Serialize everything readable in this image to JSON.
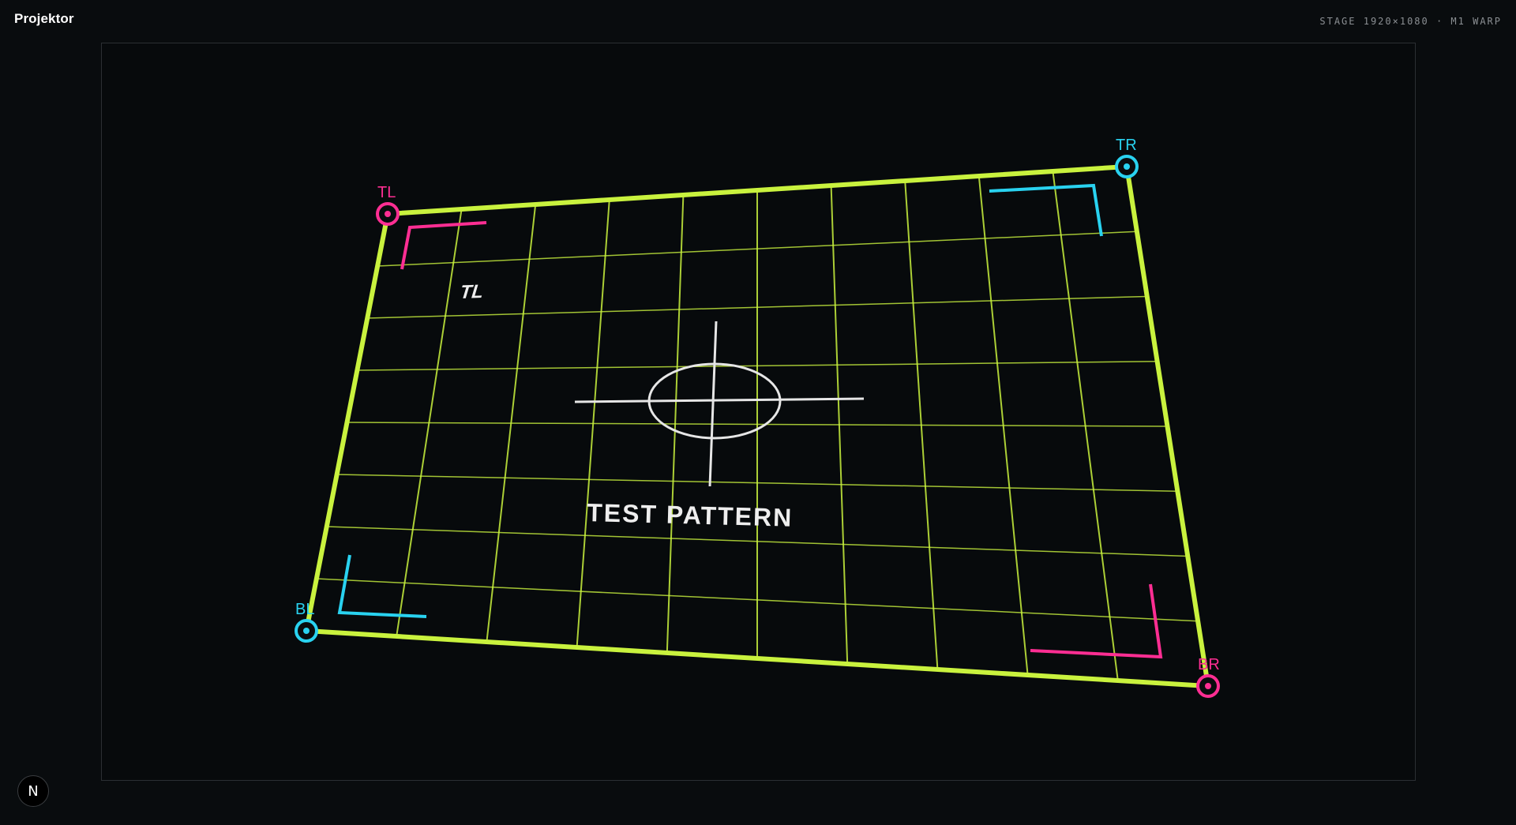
{
  "app": {
    "title": "Projektor",
    "stage_info": "STAGE 1920×1080 · M1 WARP"
  },
  "pattern": {
    "label": "TEST PATTERN",
    "corner_text": "TL"
  },
  "handles": {
    "tl": "TL",
    "tr": "TR",
    "bl": "BL",
    "br": "BR"
  },
  "badge": {
    "icon": "next-logo-icon",
    "glyph": "N"
  },
  "colors": {
    "grid": "#c9f23e",
    "magenta": "#ff2e93",
    "cyan": "#29d2f0",
    "text": "#eeeeee"
  }
}
